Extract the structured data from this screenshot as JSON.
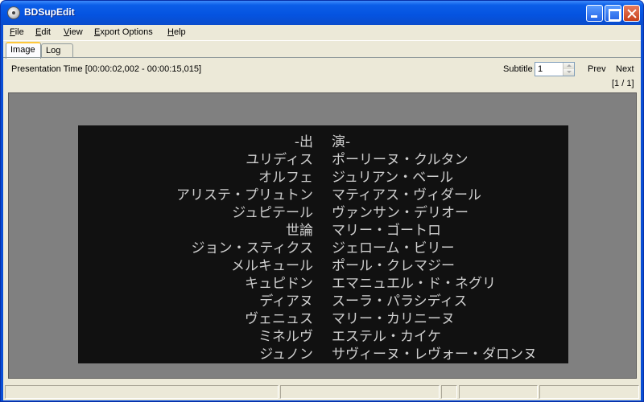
{
  "window": {
    "title": "BDSupEdit",
    "minimize_icon": "minimize-icon",
    "maximize_icon": "maximize-icon",
    "close_icon": "close-icon"
  },
  "menu": {
    "file": {
      "first": "F",
      "rest": "ile"
    },
    "edit": {
      "first": "E",
      "rest": "dit"
    },
    "view": {
      "first": "V",
      "rest": "iew"
    },
    "export": {
      "first": "E",
      "rest": "xport Options"
    },
    "help": {
      "first": "H",
      "rest": "elp"
    }
  },
  "tabs": [
    {
      "label": "Image",
      "active": true
    },
    {
      "label": "Log",
      "active": false
    }
  ],
  "toolbar": {
    "presentation_time": "Presentation Time [00:00:02,002 - 00:00:15,015]",
    "subtitle_label": "Subtitle",
    "subtitle_value": "1",
    "prev_label": "Prev",
    "next_label": "Next",
    "page_indicator": "[1 / 1]"
  },
  "subtitle_image": {
    "lines": [
      {
        "role": "-出",
        "actor": "演-"
      },
      {
        "role": "ユリディス",
        "actor": "ポーリーヌ・クルタン"
      },
      {
        "role": "オルフェ",
        "actor": "ジュリアン・ベール"
      },
      {
        "role": "アリステ・プリュトン",
        "actor": "マティアス・ヴィダール"
      },
      {
        "role": "ジュピテール",
        "actor": "ヴァンサン・デリオー"
      },
      {
        "role": "世論",
        "actor": "マリー・ゴートロ"
      },
      {
        "role": "ジョン・スティクス",
        "actor": "ジェローム・ビリー"
      },
      {
        "role": "メルキュール",
        "actor": "ポール・クレマジー"
      },
      {
        "role": "キュピドン",
        "actor": "エマニュエル・ド・ネグリ"
      },
      {
        "role": "ディアヌ",
        "actor": "スーラ・パラシディス"
      },
      {
        "role": "ヴェニュス",
        "actor": "マリー・カリニーヌ"
      },
      {
        "role": "ミネルヴ",
        "actor": "エステル・カイケ"
      },
      {
        "role": "ジュノン",
        "actor": "サヴィーヌ・レヴォー・ダロンヌ"
      }
    ]
  }
}
